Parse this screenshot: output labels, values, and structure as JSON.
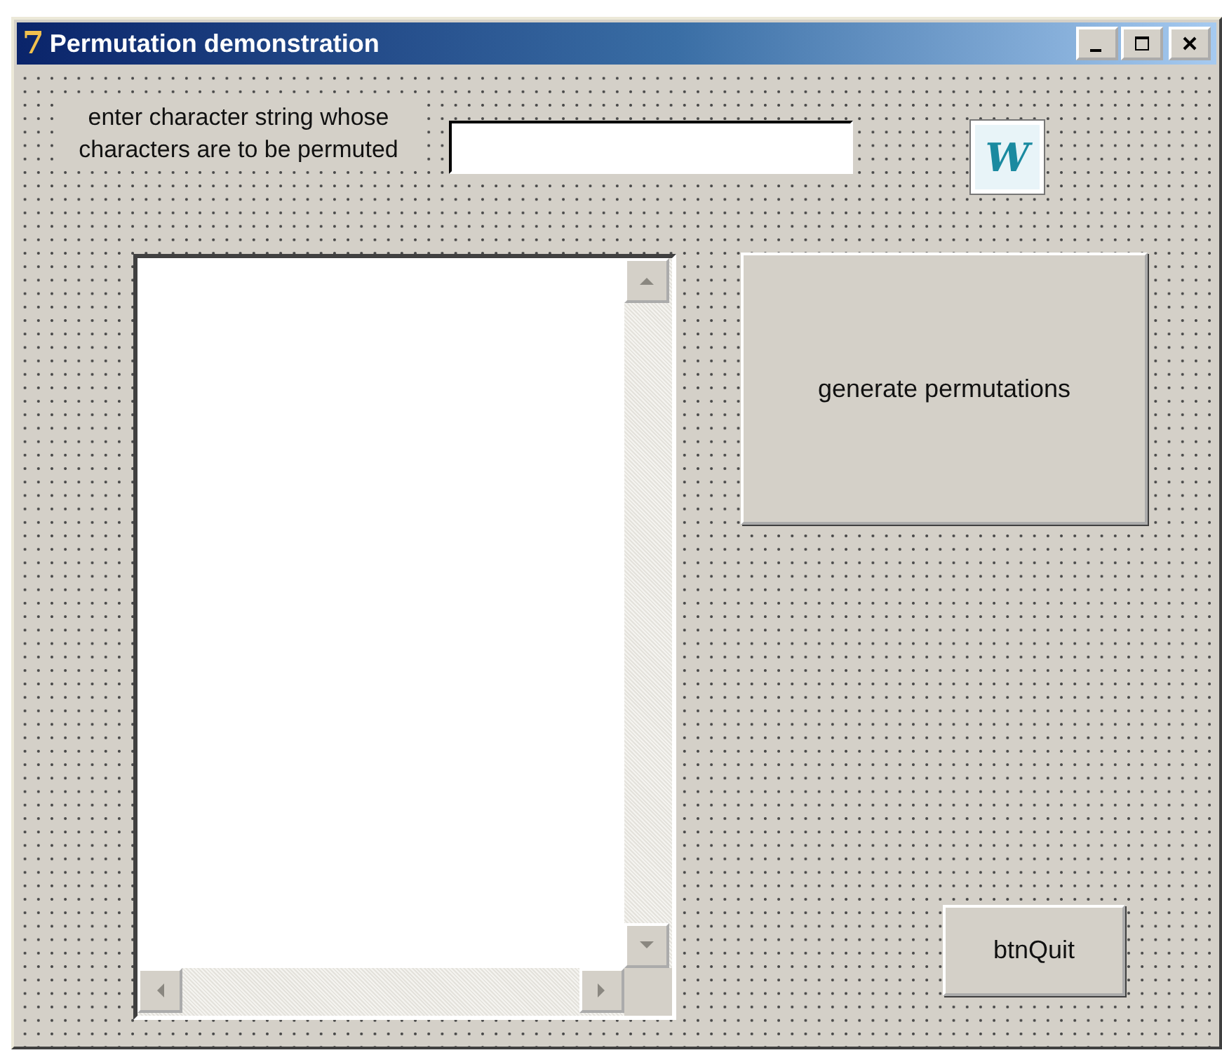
{
  "window": {
    "logo": "7",
    "title": "Permutation demonstration"
  },
  "form": {
    "prompt_label": "enter character string whose characters are to be permuted",
    "word_icon": "W",
    "generate_button": "generate permutations",
    "quit_button": "btnQuit"
  }
}
